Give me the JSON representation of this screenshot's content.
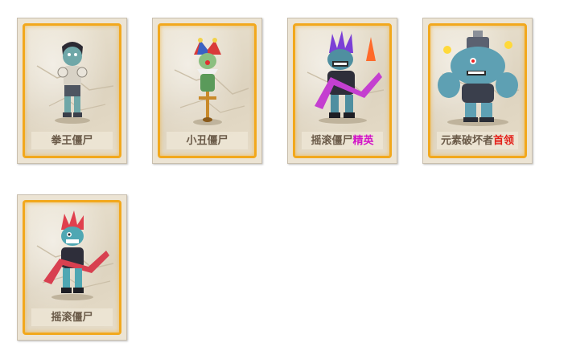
{
  "cards": [
    {
      "name": "拳王僵尸",
      "tag": "",
      "tag_type": "",
      "icon": "boxer-zombie-icon"
    },
    {
      "name": "小丑僵尸",
      "tag": "",
      "tag_type": "",
      "icon": "clown-zombie-icon"
    },
    {
      "name": "摇滚僵尸",
      "tag": "精英",
      "tag_type": "elite",
      "icon": "rock-zombie-elite-icon"
    },
    {
      "name": "元素破坏者",
      "tag": "首领",
      "tag_type": "boss",
      "icon": "element-destroyer-boss-icon"
    },
    {
      "name": "摇滚僵尸",
      "tag": "",
      "tag_type": "",
      "icon": "rock-zombie-icon"
    }
  ],
  "colors": {
    "frame": "#f2a81d",
    "elite": "#d316c8",
    "boss": "#e3211a",
    "label_text": "#6a5a48"
  }
}
